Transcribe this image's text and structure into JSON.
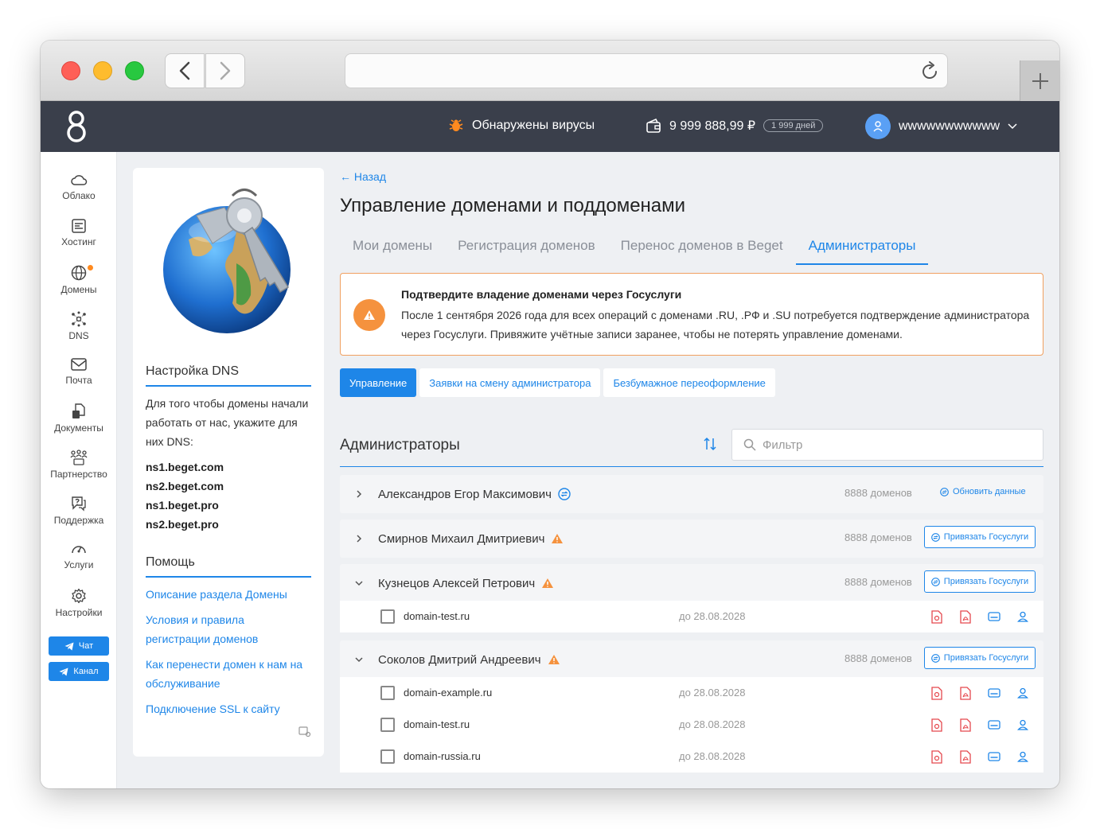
{
  "topnav": {
    "virus_text": "Обнаружены вирусы",
    "balance": "9 999 888,99 ₽",
    "days": "1 999 дней",
    "username": "wwwwwwwwwww"
  },
  "leftnav": {
    "items": [
      {
        "label": "Облако",
        "icon": "cloud-icon"
      },
      {
        "label": "Хостинг",
        "icon": "server-icon"
      },
      {
        "label": "Домены",
        "icon": "globe-icon"
      },
      {
        "label": "DNS",
        "icon": "network-icon"
      },
      {
        "label": "Почта",
        "icon": "mail-icon"
      },
      {
        "label": "Документы",
        "icon": "documents-icon"
      },
      {
        "label": "Партнерство",
        "icon": "partners-icon"
      },
      {
        "label": "Поддержка",
        "icon": "support-icon"
      },
      {
        "label": "Услуги",
        "icon": "services-icon"
      },
      {
        "label": "Настройки",
        "icon": "gear-icon"
      }
    ],
    "chat_label": "Чат",
    "channel_label": "Канал"
  },
  "sidebar": {
    "dns_title": "Настройка DNS",
    "dns_text": "Для того чтобы домены начали работать от нас, укажите для них DNS:",
    "ns": [
      "ns1.beget.com",
      "ns2.beget.com",
      "ns1.beget.pro",
      "ns2.beget.pro"
    ],
    "help_title": "Помощь",
    "help_links": [
      "Описание раздела Домены",
      "Условия и правила регистрации доменов",
      "Как перенести домен к нам на обслуживание",
      "Подключение SSL к сайту"
    ]
  },
  "main": {
    "back": "← Назад",
    "title": "Управление доменами и поддоменами",
    "tabs": [
      "Мои домены",
      "Регистрация доменов",
      "Перенос доменов в Beget",
      "Администраторы"
    ],
    "active_tab": 3,
    "alert": {
      "title": "Подтвердите владение доменами через Госуслуги",
      "text": "После 1 сентября 2026 года для всех операций с доменами .RU, .РФ и .SU потребуется подтверждение администратора через Госуслуги. Привяжите учётные записи заранее, чтобы не потерять управление доменами."
    },
    "subtabs": [
      "Управление",
      "Заявки на смену администратора",
      "Безбумажное переоформление"
    ],
    "section_title": "Администраторы",
    "filter_placeholder": "Фильтр"
  },
  "admins": [
    {
      "name": "Александров Егор Максимович",
      "count": "8888 доменов",
      "action": "Обновить данные",
      "expanded": false,
      "status": "synced"
    },
    {
      "name": "Смирнов Михаил Дмитриевич",
      "count": "8888 доменов",
      "action": "Привязать Госуслуги",
      "expanded": false,
      "status": "warning"
    },
    {
      "name": "Кузнецов Алексей Петрович",
      "count": "8888 доменов",
      "action": "Привязать Госуслуги",
      "expanded": true,
      "status": "warning",
      "domains": [
        {
          "name": "domain-test.ru",
          "date": "до 28.08.2028"
        }
      ]
    },
    {
      "name": "Соколов Дмитрий Андреевич",
      "count": "8888 доменов",
      "action": "Привязать Госуслуги",
      "expanded": true,
      "status": "warning",
      "domains": [
        {
          "name": "domain-example.ru",
          "date": "до 28.08.2028"
        },
        {
          "name": "domain-test.ru",
          "date": "до 28.08.2028"
        },
        {
          "name": "domain-russia.ru",
          "date": "до 28.08.2028"
        }
      ]
    }
  ],
  "colors": {
    "accent": "#1e86e8",
    "warning": "#f5923e",
    "topbar": "#3a3f4b",
    "pdf_red": "#e5484d"
  }
}
